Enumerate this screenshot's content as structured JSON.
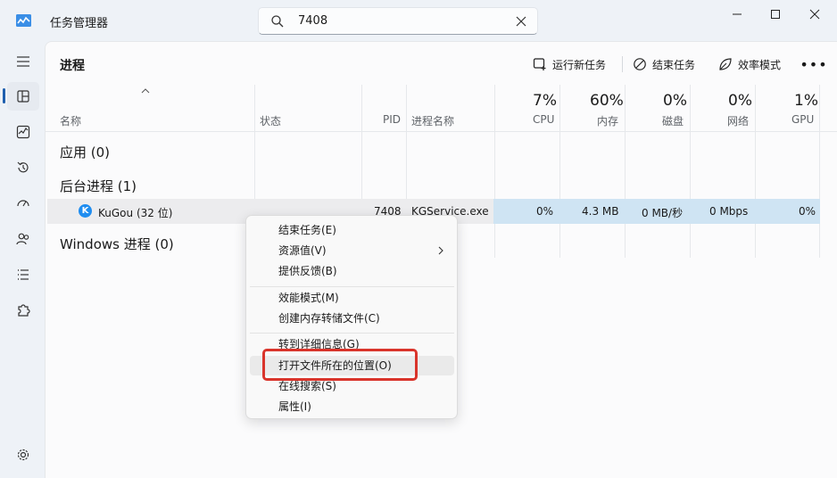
{
  "window": {
    "title": "任务管理器",
    "search_value": "7408"
  },
  "nav": {
    "items": [
      "hamburger-menu",
      "processes",
      "performance",
      "app-history",
      "startup-apps",
      "users",
      "details",
      "services",
      "settings"
    ]
  },
  "toolbar": {
    "page_title": "进程",
    "run_new_task": "运行新任务",
    "end_task": "结束任务",
    "efficiency_mode": "效率模式"
  },
  "columns": {
    "name": "名称",
    "status": "状态",
    "pid": "PID",
    "process_name": "进程名称",
    "cpu_pct": "7%",
    "cpu": "CPU",
    "memory_pct": "60%",
    "memory": "内存",
    "disk_pct": "0%",
    "disk": "磁盘",
    "network_pct": "0%",
    "network": "网络",
    "gpu_pct": "1%",
    "gpu": "GPU"
  },
  "groups": {
    "apps": "应用 (0)",
    "background": "后台进程 (1)",
    "windows": "Windows 进程 (0)"
  },
  "process": {
    "name": "KuGou (32 位)",
    "pid": "7408",
    "process_name": "KGService.exe",
    "cpu": "0%",
    "memory": "4.3 MB",
    "disk": "0 MB/秒",
    "network": "0 Mbps",
    "gpu": "0%"
  },
  "context_menu": {
    "end_task": "结束任务(E)",
    "resource_values": "资源值(V)",
    "feedback": "提供反馈(B)",
    "efficiency_mode": "效能模式(M)",
    "create_dump": "创建内存转储文件(C)",
    "go_to_details": "转到详细信息(G)",
    "open_file_location": "打开文件所在的位置(O)",
    "search_online": "在线搜索(S)",
    "properties": "属性(I)"
  },
  "colors": {
    "accent": "#1f5fae",
    "highlight_red": "#d9342b",
    "resource_cell": "#cfe4f3"
  }
}
